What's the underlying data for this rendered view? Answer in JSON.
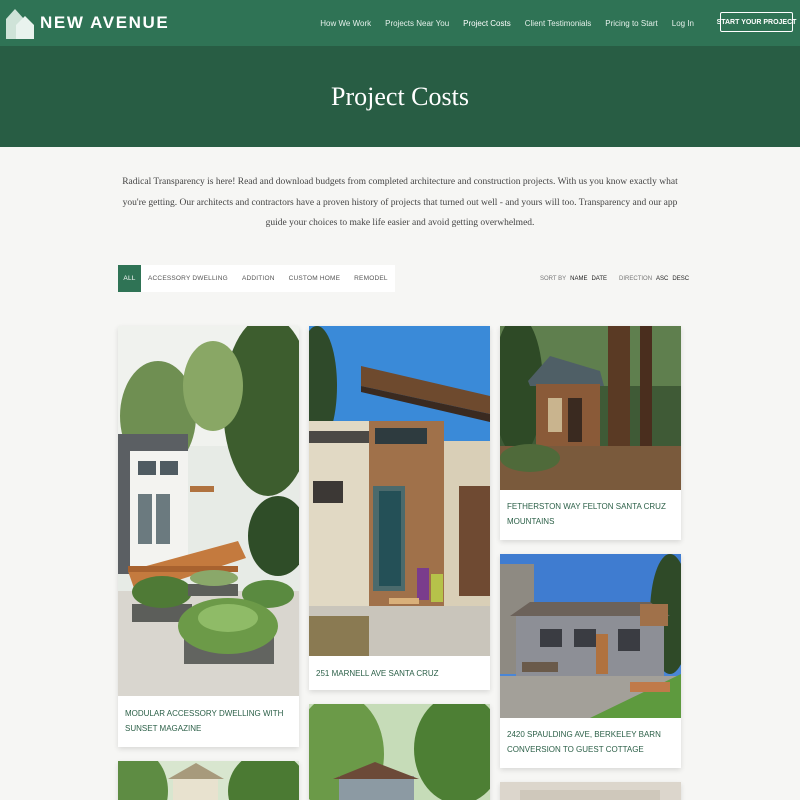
{
  "brand": {
    "name": "NEW AVENUE"
  },
  "nav": {
    "items": [
      "How We Work",
      "Projects Near You",
      "Project Costs",
      "Client Testimonials",
      "Pricing to Start",
      "Log In"
    ],
    "cta": "START YOUR PROJECT"
  },
  "hero": {
    "title": "Project Costs"
  },
  "intro": "Radical Transparency is here! Read and download budgets from completed architecture and construction projects. With us you know exactly what you're getting. Our architects and contractors have a proven history of projects that turned out well - and yours will too. Transparency and our app guide your choices to make life easier and avoid getting overwhelmed.",
  "filters": [
    "ALL",
    "ACCESSORY DWELLING",
    "ADDITION",
    "CUSTOM HOME",
    "REMODEL"
  ],
  "sort": {
    "sort_label": "SORT BY",
    "name": "NAME",
    "date": "DATE",
    "direction_label": "DIRECTION",
    "asc": "ASC",
    "desc": "DESC"
  },
  "projects": [
    {
      "title": "MODULAR ACCESSORY DWELLING WITH SUNSET MAGAZINE"
    },
    {
      "title": "251 MARNELL AVE SANTA CRUZ"
    },
    {
      "title": "FETHERSTON WAY FELTON SANTA CRUZ MOUNTAINS"
    },
    {
      "title": "2420 SPAULDING AVE, BERKELEY BARN CONVERSION TO GUEST COTTAGE"
    }
  ],
  "colors": {
    "header": "#2f7355",
    "hero": "#285d44",
    "accent": "#2f7355"
  }
}
